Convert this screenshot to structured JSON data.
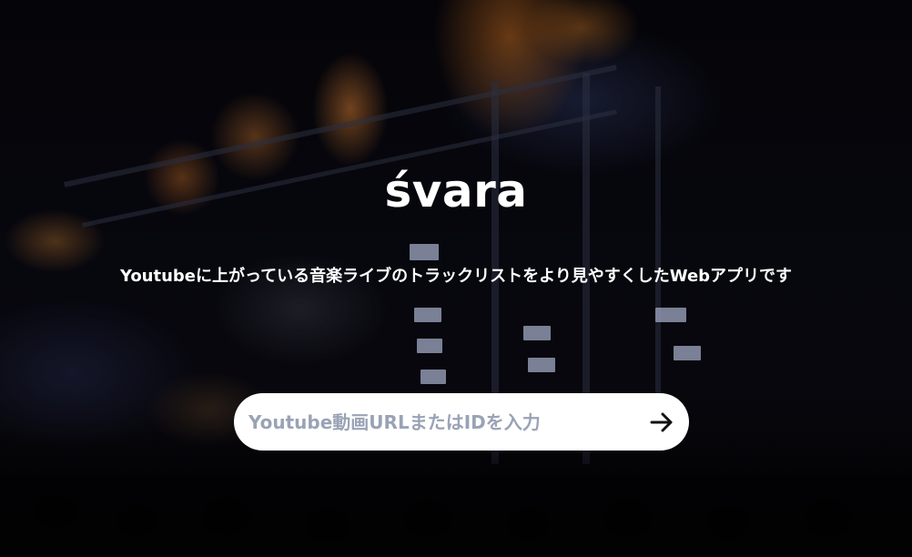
{
  "hero": {
    "title": "śvara",
    "subtitle": "Youtubeに上がっている音楽ライブのトラックリストをより見やすくしたWebアプリです"
  },
  "search": {
    "placeholder": "Youtube動画URLまたはIDを入力",
    "value": "",
    "submit_icon": "arrow-right-icon"
  },
  "colors": {
    "text": "#ffffff",
    "search_background": "#ffffff",
    "placeholder": "#9aa3b5",
    "icon": "#111111"
  }
}
